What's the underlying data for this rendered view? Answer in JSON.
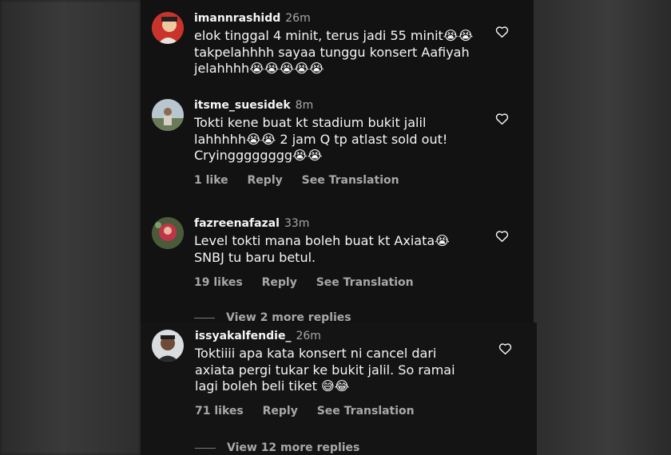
{
  "comments": [
    {
      "username": "imannrashidd",
      "time": "26m",
      "text": "elok tinggal 4 minit, terus jadi 55 minit😭😭 takpelahhhh sayaa tunggu konsert Aafiyah jelahhhh😭😭😭😭😭"
    },
    {
      "username": "itsme_suesidek",
      "time": "8m",
      "text": "Tokti kene buat kt stadium bukit jalil lahhhhh😭😭 2 jam Q tp atlast sold out! Cryingggggggg😭😭",
      "likes": "1 like",
      "reply": "Reply",
      "translate": "See Translation"
    },
    {
      "username": "fazreenafazal",
      "time": "33m",
      "text": "Level tokti mana boleh buat kt Axiata😭 SNBJ tu baru betul.",
      "likes": "19 likes",
      "reply": "Reply",
      "translate": "See Translation",
      "more_replies": "View 2 more replies"
    },
    {
      "username": "issyakalfendie_",
      "time": "26m",
      "text": "Toktiiii apa kata konsert ni cancel dari axiata pergi tukar ke bukit jalil. So ramai lagi boleh beli tiket 😅😂",
      "likes": "71 likes",
      "reply": "Reply",
      "translate": "See Translation",
      "more_replies": "View 12 more replies"
    }
  ],
  "icons": {
    "like": "heart-outline-icon"
  },
  "colors": {
    "background": "#121212",
    "text": "#f5f5f5",
    "muted": "#a8a8a8"
  }
}
